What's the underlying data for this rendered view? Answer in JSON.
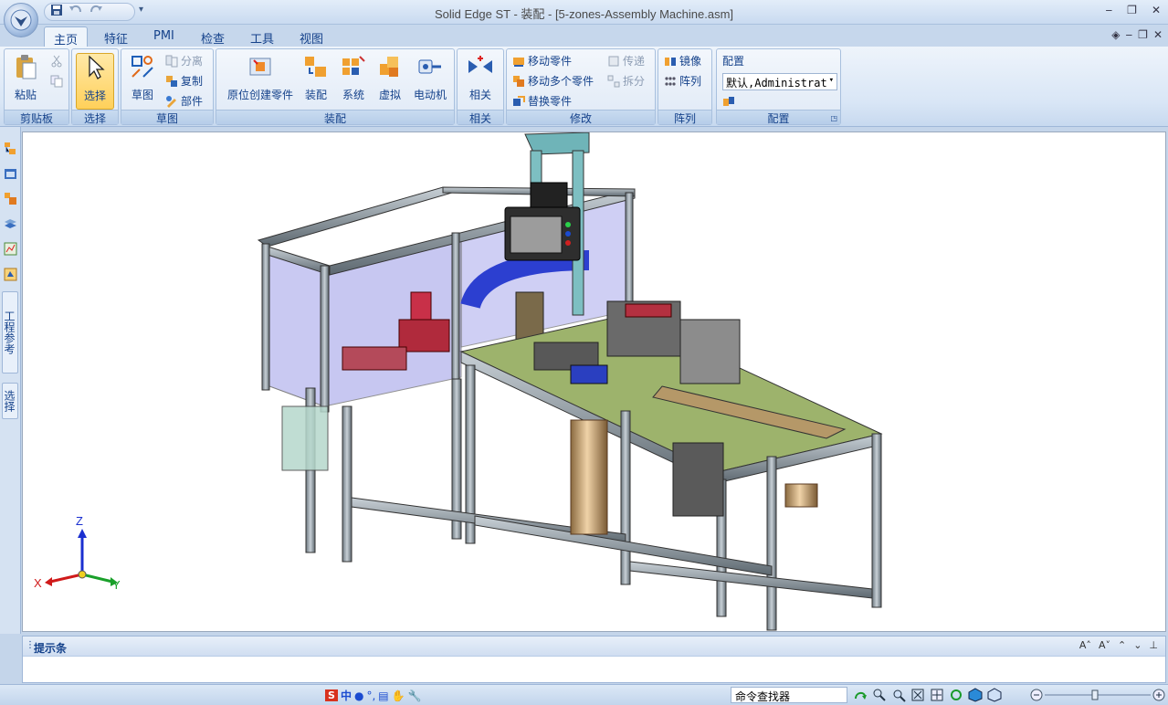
{
  "window": {
    "title": "Solid Edge ST - 装配 - [5-zones-Assembly Machine.asm]",
    "controls": [
      "minimize",
      "restore",
      "close"
    ]
  },
  "quick_access": {
    "items": [
      "save-icon",
      "undo-icon",
      "redo-icon"
    ],
    "more": "▾"
  },
  "tabs": [
    {
      "label": "主页",
      "active": true
    },
    {
      "label": "特征"
    },
    {
      "label": "PMI"
    },
    {
      "label": "检查"
    },
    {
      "label": "工具"
    },
    {
      "label": "视图"
    }
  ],
  "ribbon": {
    "clipboard": {
      "label": "剪贴板",
      "paste": "粘贴"
    },
    "select": {
      "label": "选择",
      "select": "选择"
    },
    "sketch": {
      "label": "草图",
      "sketch": "草图",
      "split": "分离",
      "copy": "复制",
      "part": "部件"
    },
    "assembly": {
      "label": "装配",
      "create_in_place": "原位创建零件",
      "assemble": "装配",
      "system": "系统",
      "virtual": "虚拟",
      "motor": "电动机"
    },
    "relate": {
      "label": "相关",
      "relate": "相关"
    },
    "modify": {
      "label": "修改",
      "move_part": "移动零件",
      "move_multiple": "移动多个零件",
      "replace_part": "替换零件",
      "transfer": "传递",
      "disperse": "拆分"
    },
    "pattern": {
      "label": "阵列",
      "mirror": "镜像",
      "pattern": "阵列"
    },
    "config": {
      "label": "配置",
      "title": "配置",
      "value": "默认,Administrat"
    }
  },
  "left_rail": {
    "tab_engineering": "工程参考",
    "tab_select": "选择"
  },
  "viewport": {
    "triad": {
      "z": "Z",
      "x": "X",
      "y": "Y"
    },
    "background": "#ffffff"
  },
  "prompt_bar": {
    "title": "提示条",
    "tools": [
      "A˄",
      "A˅",
      "⌃",
      "⌄",
      "⊥"
    ]
  },
  "status_bar": {
    "ime": [
      "S",
      "中"
    ],
    "command_finder": "命令查找器"
  },
  "colors": {
    "ribbon_text": "#15428b",
    "frame": "#c4d5ea",
    "selected_button": "#ffd05a"
  }
}
